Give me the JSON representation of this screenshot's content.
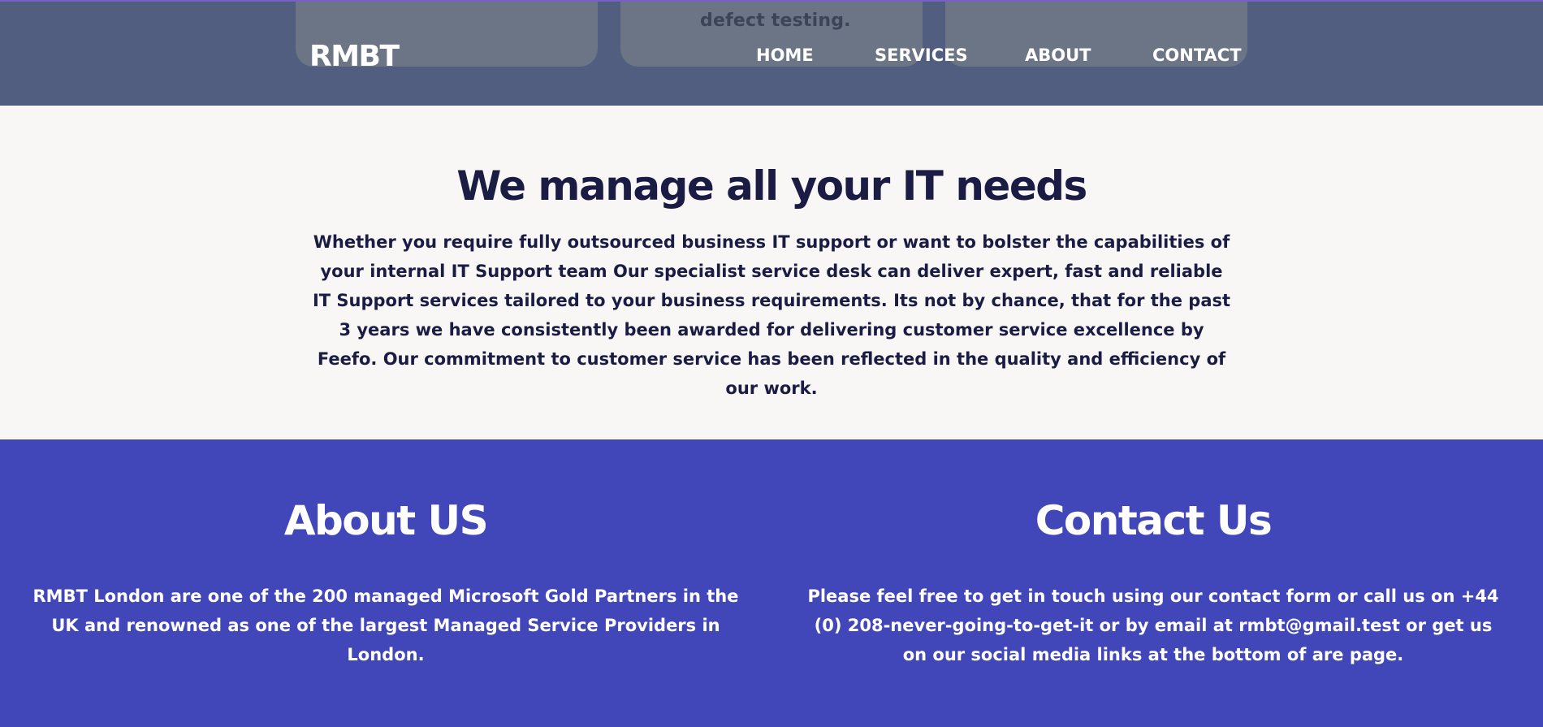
{
  "header": {
    "logo": "RMBT",
    "partial_card_text": "defect testing.",
    "nav": {
      "home": "HOME",
      "services": "SERVICES",
      "about": "ABOUT",
      "contact": "CONTACT"
    }
  },
  "intro": {
    "title": "We manage all your IT needs",
    "text": "Whether you require fully outsourced business IT support or want to bolster the capabilities of your internal IT Support team Our specialist service desk can deliver expert, fast and reliable IT Support services tailored to your business requirements. Its not by chance, that for the past 3 years we have consistently been awarded for delivering customer service excellence by Feefo. Our commitment to customer service has been reflected in the quality and efficiency of our work."
  },
  "about": {
    "title": "About US",
    "text": "RMBT London are one of the 200 managed Microsoft Gold Partners in the UK and renowned as one of the largest Managed Service Providers in London."
  },
  "contact": {
    "title": "Contact Us",
    "text": "Please feel free to get in touch using our contact form or call us on +44 (0) 208-never-going-to-get-it or by email at rmbt@gmail.test or get us on our social media links at the bottom of are page."
  },
  "colors": {
    "header_bg": "#515e7f",
    "intro_bg": "#f8f7f6",
    "heading_text": "#1b1c43",
    "bottom_bg": "#4146b9",
    "accent_top_border": "#7b5fc7"
  }
}
